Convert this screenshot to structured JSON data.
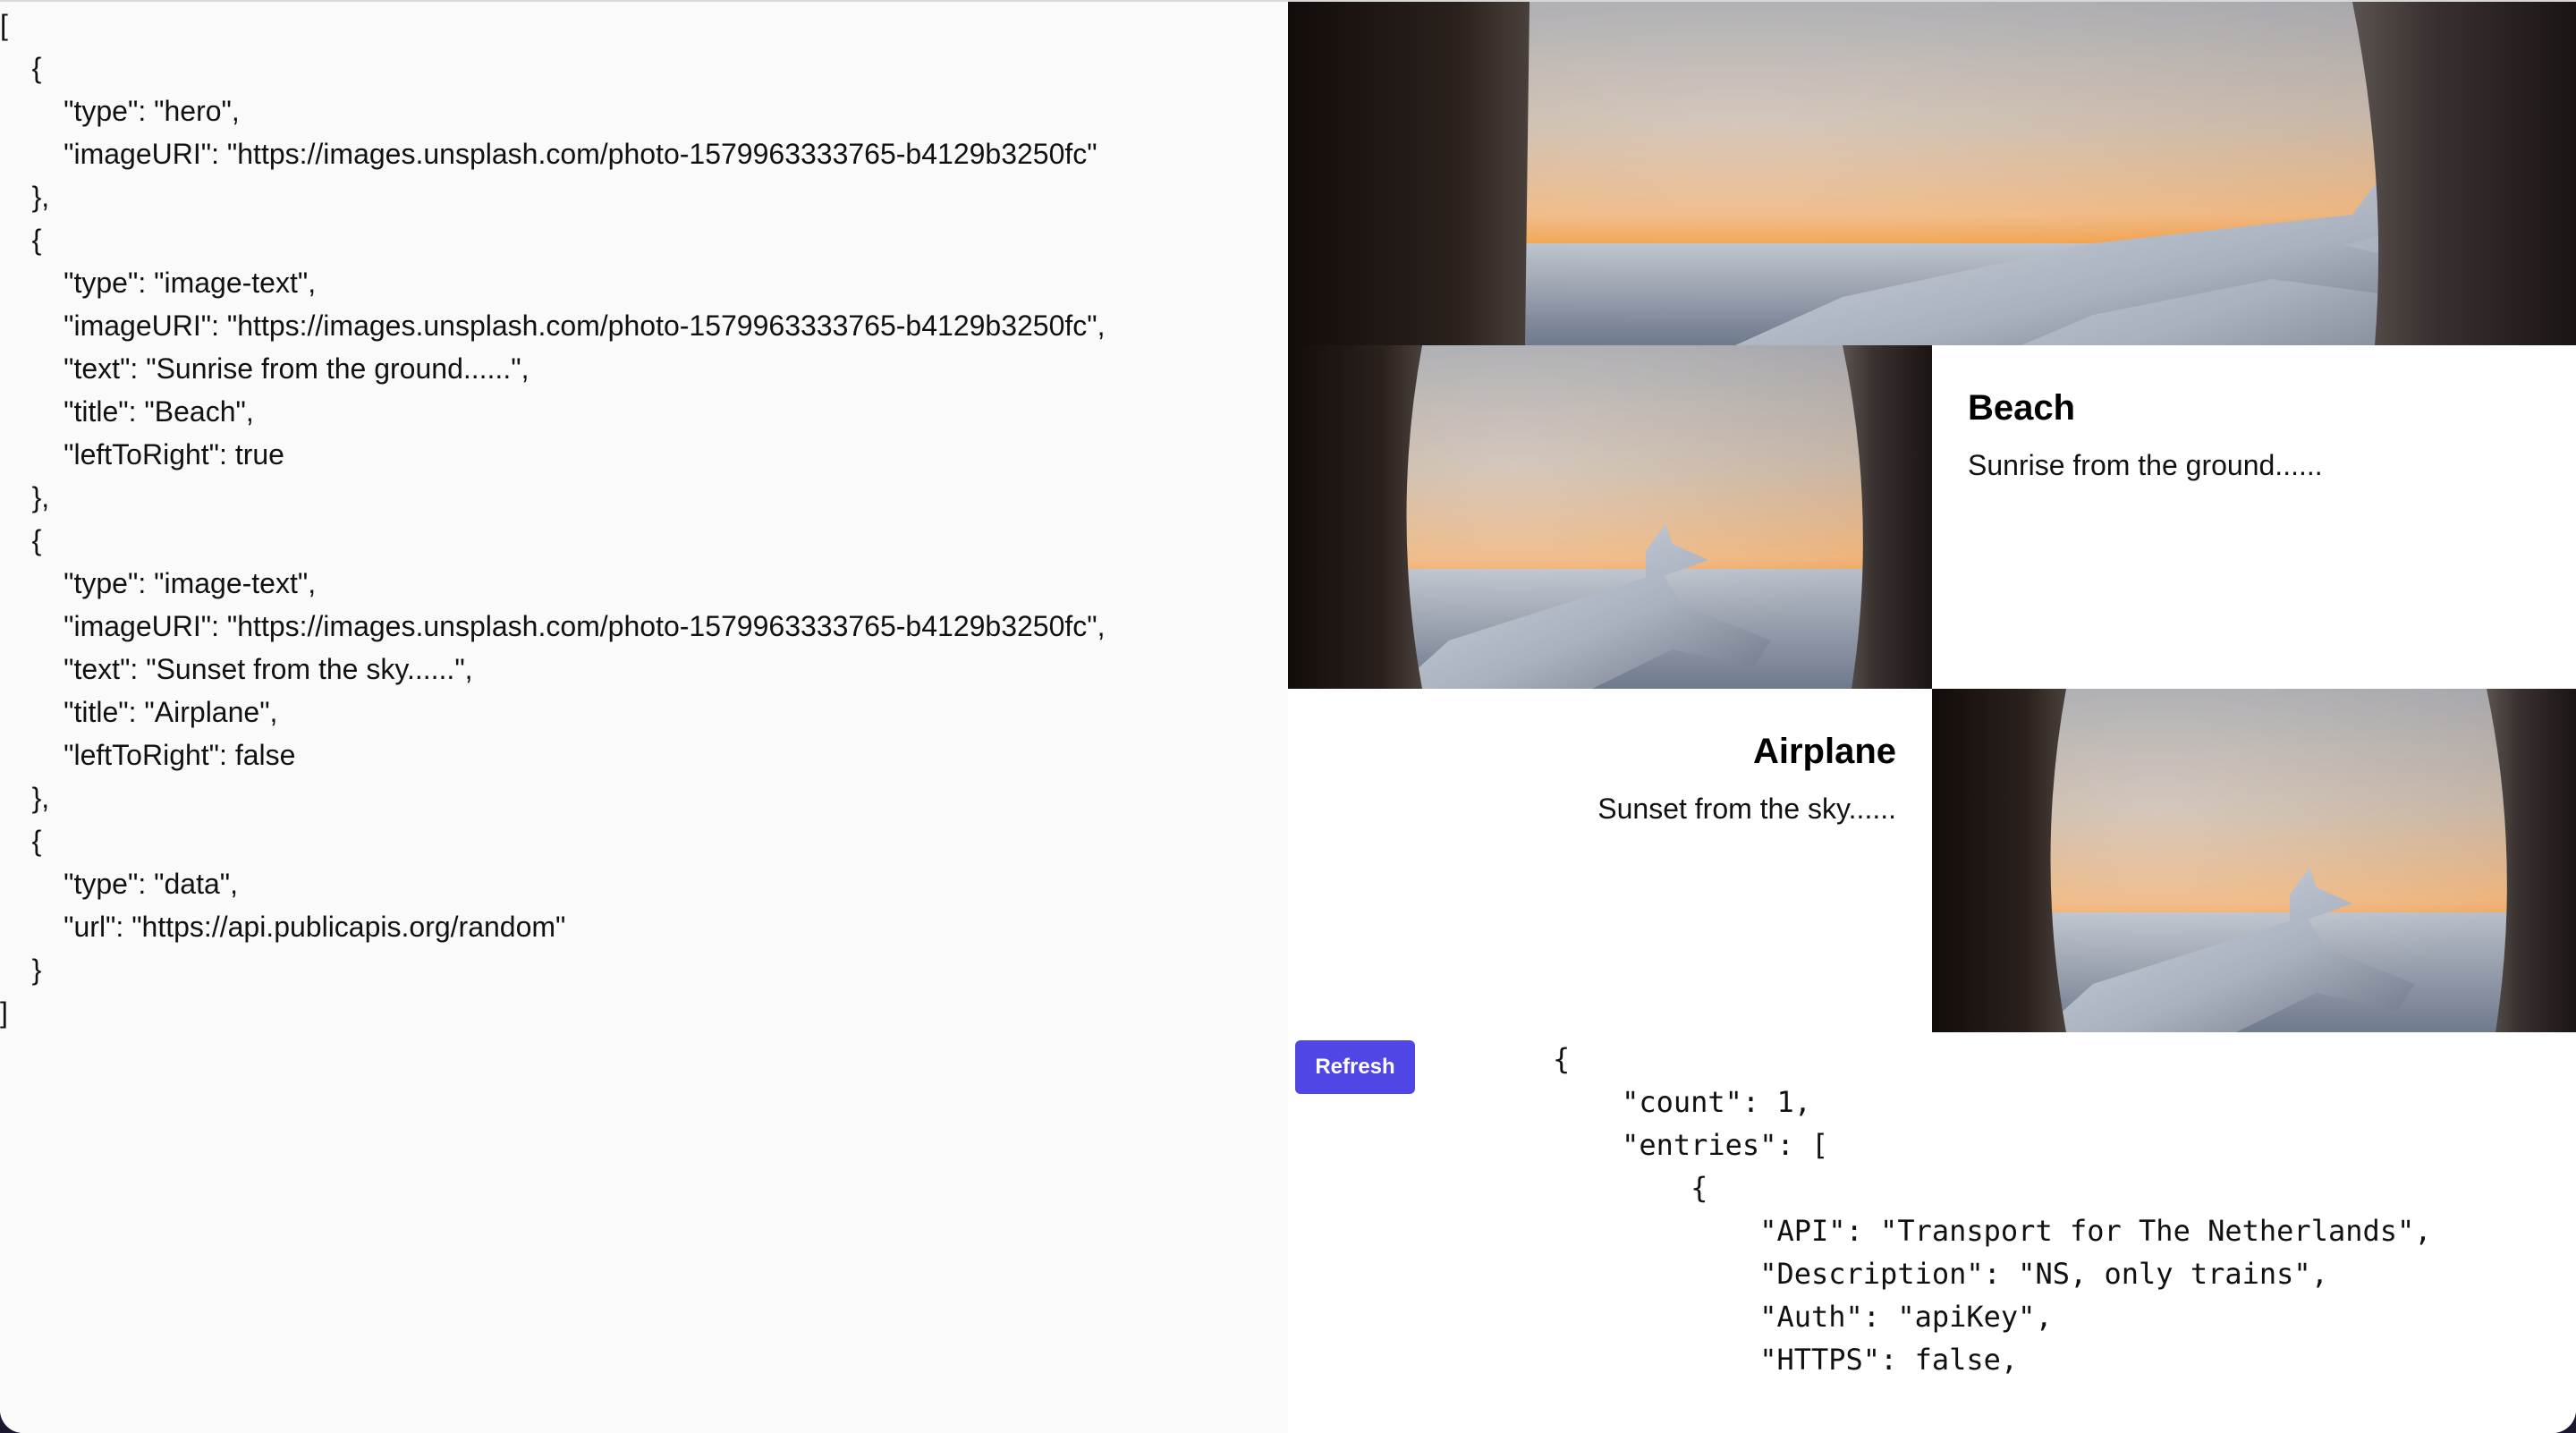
{
  "editor": {
    "lines": [
      "[",
      "    {",
      "        \"type\": \"hero\",",
      "        \"imageURI\": \"https://images.unsplash.com/photo-1579963333765-b4129b3250fc\"",
      "    },",
      "    {",
      "        \"type\": \"image-text\",",
      "        \"imageURI\": \"https://images.unsplash.com/photo-1579963333765-b4129b3250fc\",",
      "        \"text\": \"Sunrise from the ground......\",",
      "        \"title\": \"Beach\",",
      "        \"leftToRight\": true",
      "    },",
      "    {",
      "        \"type\": \"image-text\",",
      "        \"imageURI\": \"https://images.unsplash.com/photo-1579963333765-b4129b3250fc\",",
      "        \"text\": \"Sunset from the sky......\",",
      "        \"title\": \"Airplane\",",
      "        \"leftToRight\": false",
      "    },",
      "    {",
      "        \"type\": \"data\",",
      "        \"url\": \"https://api.publicapis.org/random\"",
      "    }",
      "]"
    ]
  },
  "preview": {
    "image_text_1": {
      "title": "Beach",
      "text": "Sunrise from the ground......"
    },
    "image_text_2": {
      "title": "Airplane",
      "text": "Sunset from the sky......"
    },
    "refresh_label": "Refresh",
    "data_lines": [
      "{",
      "    \"count\": 1,",
      "    \"entries\": [",
      "        {",
      "            \"API\": \"Transport for The Netherlands\",",
      "            \"Description\": \"NS, only trains\",",
      "            \"Auth\": \"apiKey\",",
      "            \"HTTPS\": false,"
    ]
  },
  "colors": {
    "accent": "#4f46e5",
    "editor_bg": "#fafafa"
  },
  "icons": {
    "photo": "airplane-wing-window-photo"
  }
}
